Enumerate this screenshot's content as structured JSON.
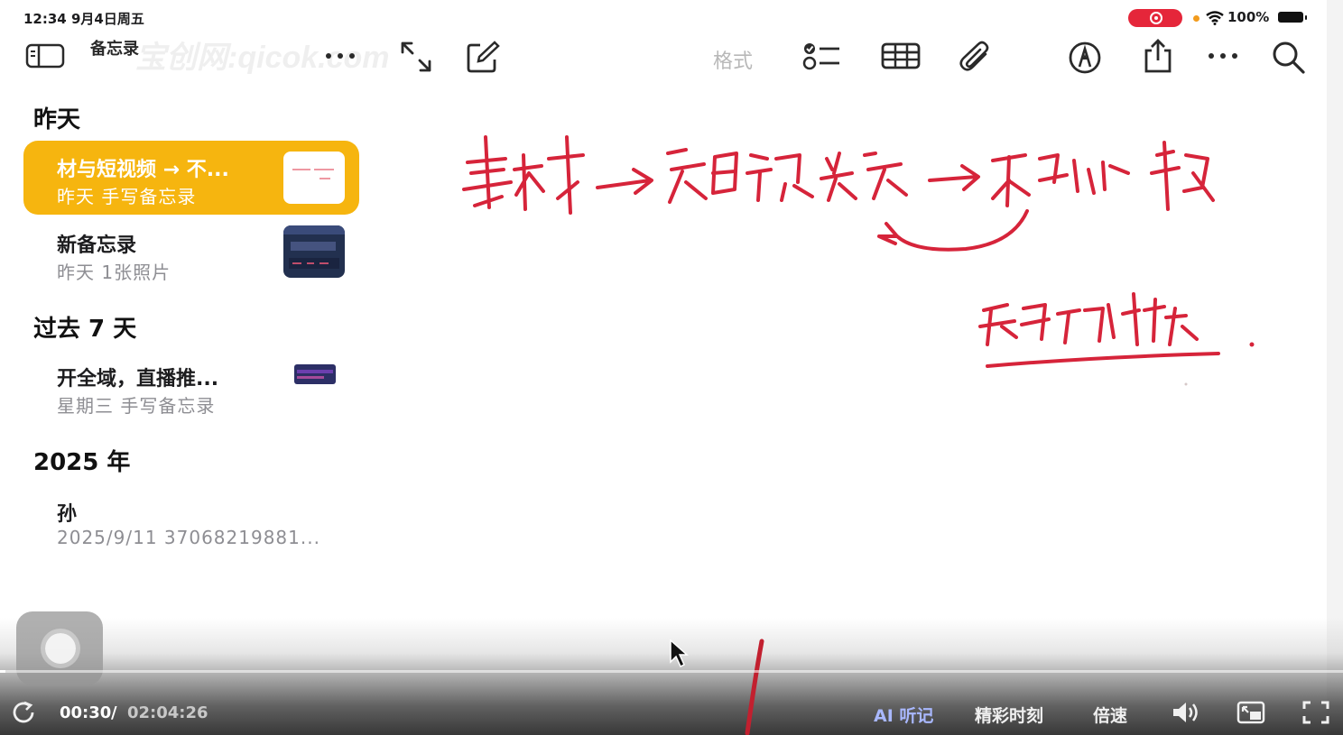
{
  "status_bar": {
    "time": "12:34  9月4日周五",
    "battery": "100%"
  },
  "toolbar": {
    "app_name": "备忘录",
    "watermark": "宝创网:qicok.com",
    "format_label": "格式"
  },
  "sidebar": {
    "sections": [
      {
        "header": "昨天"
      },
      {
        "header": "过去 7 天"
      },
      {
        "header": "2025 年"
      }
    ],
    "notes": [
      {
        "title": "材与短视频 → 不...",
        "subtitle": "昨天  手写备忘录"
      },
      {
        "title": "新备忘录",
        "subtitle": "昨天  1张照片"
      },
      {
        "title": "开全域，直播推...",
        "subtitle": "星期三  手写备忘录"
      },
      {
        "title": "孙",
        "subtitle": "2025/9/11  37068219881..."
      }
    ]
  },
  "player": {
    "current_time": "00:30",
    "separator": "/",
    "total_time": "02:04:26",
    "progress": 0.004,
    "ai_label": "AI 听记",
    "highlights_label": "精彩时刻",
    "speed_label": "倍速"
  },
  "colors": {
    "accent_yellow": "#f6b50f",
    "ink_red": "#d6243a",
    "record_red": "#e5263a"
  },
  "icons": [
    "sidebar-toggle-icon",
    "more-icon",
    "expand-icon",
    "compose-icon",
    "checklist-icon",
    "table-icon",
    "paperclip-icon",
    "markup-icon",
    "share-icon",
    "search-icon",
    "replay-icon",
    "volume-icon",
    "pip-icon",
    "fullscreen-icon",
    "cursor-icon"
  ]
}
